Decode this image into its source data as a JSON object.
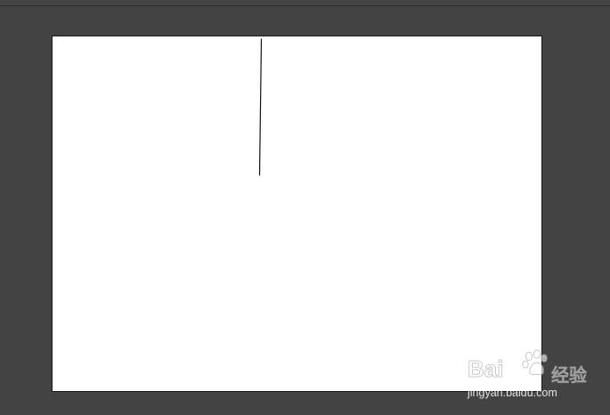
{
  "canvas": {
    "background_color": "#434343",
    "artboard_color": "#ffffff",
    "stroke_color": "#111111"
  },
  "watermark": {
    "logo_text": "Bai",
    "logo_suffix": "经验",
    "url": "jingyan.baidu.com"
  }
}
